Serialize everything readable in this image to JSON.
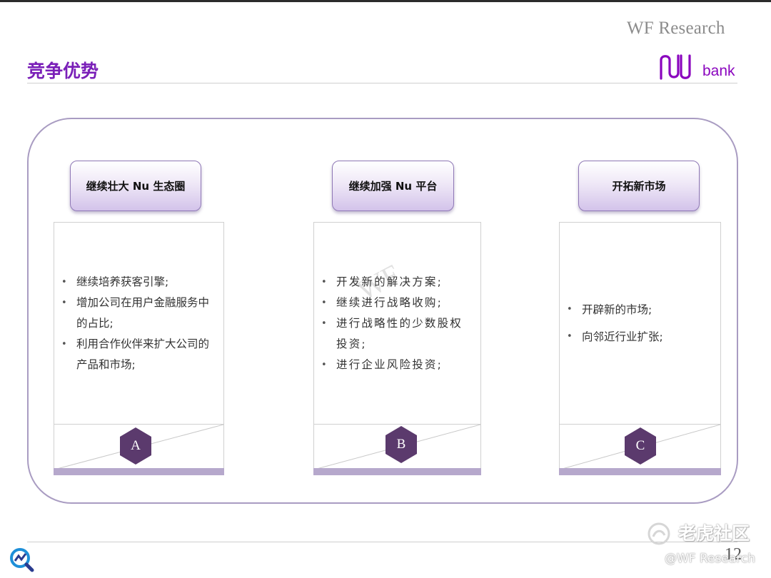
{
  "header": {
    "brand": "WF Research",
    "title": "竞争优势",
    "logo": {
      "icon": "nubank-logo-icon",
      "text": "bank",
      "color": "#8a05be"
    }
  },
  "watermark": "WF",
  "columns": [
    {
      "id": "a",
      "heading": "继续壮大 Nu 生态圈",
      "letter": "A",
      "bullets": [
        "继续培养获客引擎;",
        "增加公司在用户金融服务中的占比;",
        "利用合作伙伴来扩大公司的产品和市场;"
      ]
    },
    {
      "id": "b",
      "heading": "继续加强 Nu 平台",
      "letter": "B",
      "bullets": [
        "开发新的解决方案;",
        "继续进行战略收购;",
        "进行战略性的少数股权投资;",
        "进行企业风险投资;"
      ]
    },
    {
      "id": "c",
      "heading": "开拓新市场",
      "letter": "C",
      "bullets": [
        "开辟新的市场;",
        "向邻近行业扩张;"
      ]
    }
  ],
  "footer": {
    "page_number": "12",
    "overlay_brand": "老虎社区",
    "overlay_credit": "@WF Research"
  },
  "colors": {
    "title": "#7a1fb8",
    "hex": "#5b3a6d",
    "frame": "#a99cc2",
    "bar": "#b6a8cc"
  }
}
